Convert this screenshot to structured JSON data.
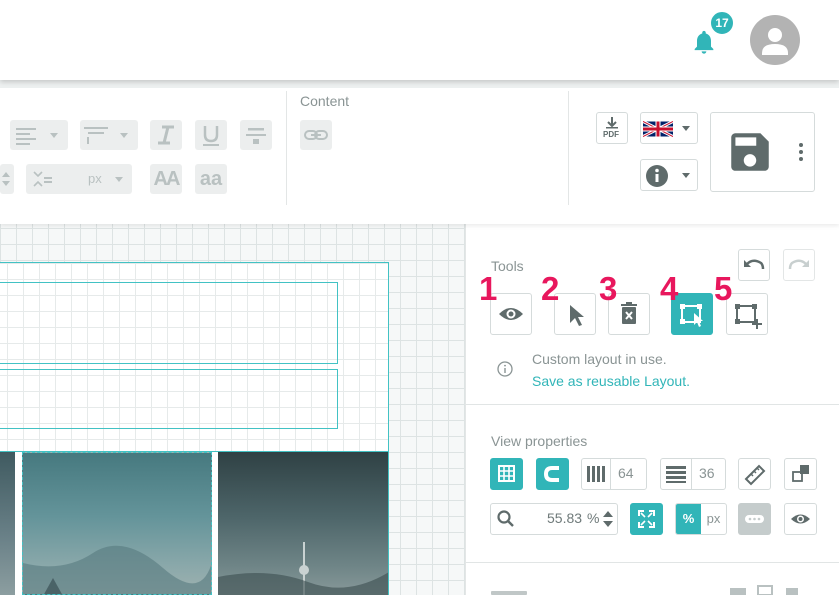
{
  "header": {
    "notification_count": "17"
  },
  "toolbar": {
    "content_section_label": "Content",
    "font_size_unit": "px",
    "pdf_icon_text": "PDF",
    "text_big": "AA",
    "text_small": "aa"
  },
  "tools": {
    "title": "Tools",
    "markers": [
      "1",
      "2",
      "3",
      "4",
      "5"
    ],
    "info_text": "Custom layout in use.",
    "save_link": "Save as reusable Layout."
  },
  "view_properties": {
    "title": "View properties",
    "columns_value": "64",
    "rows_value": "36",
    "zoom_value": "55.83",
    "zoom_unit": "%",
    "unit_percent": "%",
    "unit_px": "px"
  },
  "colors": {
    "accent": "#31b5b8",
    "marker": "#e8175d",
    "muted": "#8a9494"
  }
}
